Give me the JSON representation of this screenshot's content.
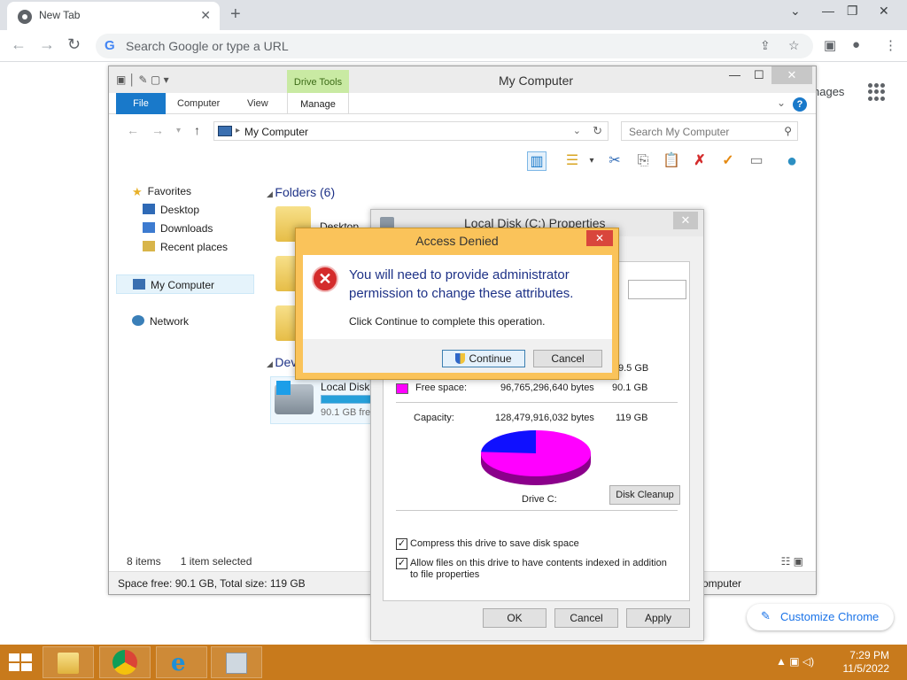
{
  "chrome": {
    "tab_title": "New Tab",
    "tab_close": "✕",
    "new_tab": "+",
    "window_minimize": "⌄",
    "window_min": "—",
    "window_restore": "❐",
    "window_close": "✕",
    "back": "←",
    "forward": "→",
    "reload": "↻",
    "omnibox_g": "G",
    "omnibox_placeholder": "Search Google or type a URL",
    "share": "⇪",
    "star": "☆",
    "sidepanel": "▣",
    "profile": "●",
    "menu": "⋮",
    "ntp_images_partial": "nages",
    "customize_label": "Customize Chrome",
    "pencil": "✎"
  },
  "explorer": {
    "title": "My Computer",
    "quick_access": "▣ │ ✎ ▢ ▾",
    "minimize": "—",
    "maximize": "☐",
    "close": "✕",
    "drive_tools": "Drive Tools",
    "tabs": {
      "file": "File",
      "computer": "Computer",
      "view": "View",
      "manage": "Manage"
    },
    "ribbon_chevron": "⌄",
    "help": "?",
    "nav_back": "←",
    "nav_forward": "→",
    "nav_recent": "▾",
    "nav_up": "↑",
    "address_sep": "▸",
    "address": "My Computer",
    "address_dropdown": "⌄",
    "refresh": "↻",
    "search_placeholder": "Search My Computer",
    "search_glyph": "⚲",
    "toolbar_glyphs": [
      "▥",
      "☰",
      "▾",
      "✂",
      "⎘",
      "📋",
      "✗",
      "✓",
      "▭",
      "●"
    ],
    "nav": {
      "favorites": "Favorites",
      "desktop": "Desktop",
      "downloads": "Downloads",
      "recent_places": "Recent places",
      "my_computer": "My Computer",
      "network": "Network"
    },
    "folders_header": "Folders (6)",
    "folder_first": "Desktop",
    "devices_header": "Dev",
    "drive_label": "Local Disk",
    "drive_free": "90.1 GB fre",
    "items_count": "8 items",
    "items_selected": "1 item selected",
    "view_icons": "☷ ▣",
    "space_info": "Space free: 90.1 GB, Total size: 119 GB",
    "details_right": "omputer"
  },
  "properties": {
    "title": "Local Disk (C:) Properties",
    "close": "✕",
    "used_partial_gb": "9.5 GB",
    "free_label": "Free space:",
    "free_bytes": "96,765,296,640 bytes",
    "free_gb": "90.1 GB",
    "capacity_label": "Capacity:",
    "capacity_bytes": "128,479,916,032 bytes",
    "capacity_gb": "119 GB",
    "used_fraction": 0.24,
    "drive_label": "Drive C:",
    "disk_cleanup": "Disk Cleanup",
    "compress_label": "Compress this drive to save disk space",
    "compress_checked": "✓",
    "index_label": "Allow files on this drive to have contents indexed in addition to file properties",
    "index_checked": "✓",
    "ok": "OK",
    "cancel": "Cancel",
    "apply": "Apply",
    "colors": {
      "used": "#1010ff",
      "free": "#ff00ff"
    }
  },
  "access_denied": {
    "title": "Access Denied",
    "close": "✕",
    "error_glyph": "✕",
    "message": "You will need to provide administrator permission to change these attributes.",
    "sub": "Click Continue to complete this operation.",
    "continue": "Continue",
    "cancel": "Cancel"
  },
  "taskbar": {
    "tray": "▲ ▣ ◁)",
    "time": "7:29 PM",
    "date": "11/5/2022"
  }
}
